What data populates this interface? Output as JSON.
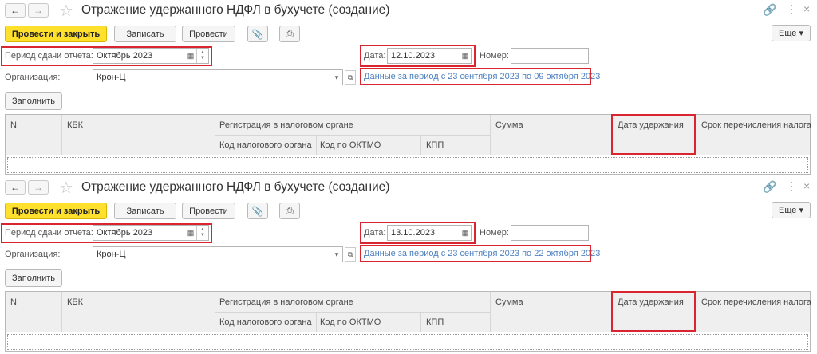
{
  "panels": [
    {
      "title": "Отражение удержанного НДФЛ в бухучете (создание)",
      "buttons": {
        "post_close": "Провести и закрыть",
        "save": "Записать",
        "post": "Провести",
        "more": "Еще ▾"
      },
      "period_label": "Период сдачи отчета:",
      "period_value": "Октябрь 2023",
      "date_label": "Дата:",
      "date_value": "12.10.2023",
      "number_label": "Номер:",
      "number_value": "",
      "org_label": "Организация:",
      "org_value": "Крон-Ц",
      "data_link": "Данные за период с 23 сентября 2023 по 09 октября 2023",
      "fill_button": "Заполнить",
      "table": {
        "col_n": "N",
        "col_kbk": "КБК",
        "col_registration": "Регистрация в налоговом органе",
        "col_tax_code": "Код налогового органа",
        "col_oktmo": "Код по ОКТМО",
        "col_kpp": "КПП",
        "col_sum": "Сумма",
        "col_withhold_date": "Дата удержания",
        "col_transfer_deadline": "Срок перечисления налога"
      }
    },
    {
      "title": "Отражение удержанного НДФЛ в бухучете (создание)",
      "buttons": {
        "post_close": "Провести и закрыть",
        "save": "Записать",
        "post": "Провести",
        "more": "Еще ▾"
      },
      "period_label": "Период сдачи отчета:",
      "period_value": "Октябрь 2023",
      "date_label": "Дата:",
      "date_value": "13.10.2023",
      "number_label": "Номер:",
      "number_value": "",
      "org_label": "Организация:",
      "org_value": "Крон-Ц",
      "data_link": "Данные за период с 23 сентября 2023 по 22 октября 2023",
      "fill_button": "Заполнить",
      "table": {
        "col_n": "N",
        "col_kbk": "КБК",
        "col_registration": "Регистрация в налоговом органе",
        "col_tax_code": "Код налогового органа",
        "col_oktmo": "Код по ОКТМО",
        "col_kpp": "КПП",
        "col_sum": "Сумма",
        "col_withhold_date": "Дата удержания",
        "col_transfer_deadline": "Срок перечисления налога"
      }
    }
  ],
  "icons": {
    "back": "back-arrow-icon",
    "forward": "forward-arrow-icon",
    "star": "star-icon",
    "link": "link-icon",
    "menu": "more-vertical-icon",
    "close": "close-icon",
    "attach": "paperclip-icon",
    "print": "printer-icon",
    "calendar": "calendar-icon",
    "dropdown": "dropdown-arrow-icon",
    "open": "open-form-icon"
  },
  "colors": {
    "primary_button": "#ffe02d",
    "highlight_frame": "#d9252f",
    "link": "#4d7fbf"
  }
}
